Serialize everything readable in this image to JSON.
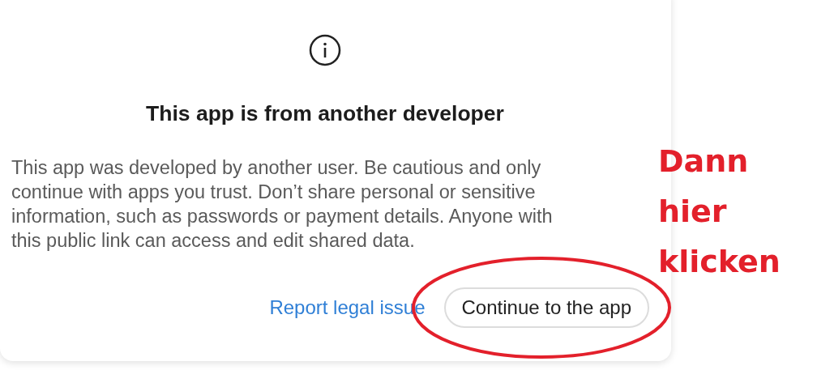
{
  "dialog": {
    "title": "This app is from another developer",
    "message": "This app was developed by another user. Be cautious and only continue with apps you trust. Don’t share personal or sensitive information, such as passwords or payment details. Anyone with this public link can access and edit shared data.",
    "link": "Report legal issue",
    "button": "Continue to the app"
  },
  "annotation": {
    "text": "Dann hier klicken"
  }
}
